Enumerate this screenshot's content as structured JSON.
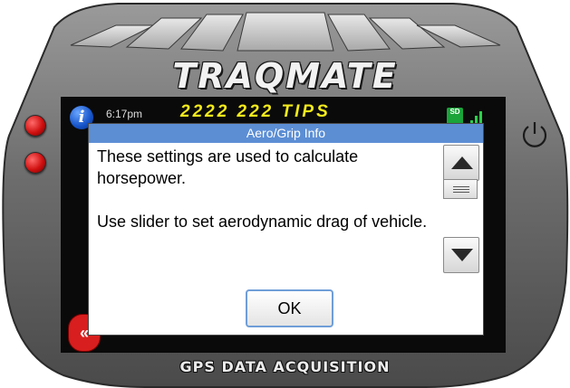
{
  "device": {
    "brand": "TRAQMATE",
    "tagline": "GPS DATA ACQUISITION",
    "power_icon": "power-icon"
  },
  "status_bar": {
    "time": "6:17pm",
    "title": "2222 222 TIPS",
    "info_icon": "i",
    "sd_label": "SD"
  },
  "back_button": {
    "label": "«"
  },
  "dialog": {
    "title": "Aero/Grip Info",
    "body": [
      "These settings are used to calculate horsepower.",
      "Use slider to set aerodynamic drag of vehicle."
    ],
    "ok_label": "OK"
  },
  "colors": {
    "dialog_title_bg": "#5c8ed4",
    "ok_border": "#6f9ed8",
    "status_title": "#f3ea1b",
    "bezel": "#6a6a6a"
  }
}
